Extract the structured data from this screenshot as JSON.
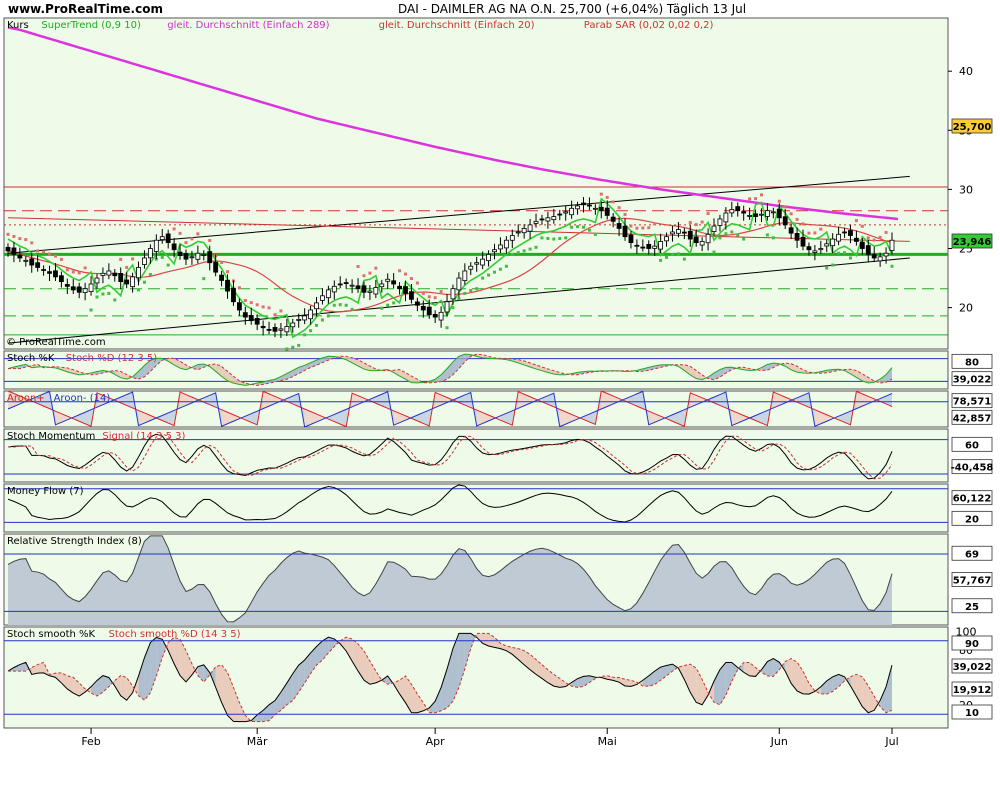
{
  "header": {
    "site": "www.ProRealTime.com",
    "title": "DAI - DAIMLER AG NA O.N.   25,700 (+6,04%)   Täglich  13 Jul",
    "copyright": "© ProRealTime.com"
  },
  "colors": {
    "panel_bg": "#eefbe8",
    "supertrend": "#33cc33",
    "sma289": "#dd33dd",
    "sma20": "#dd4444",
    "sar": "#e07070",
    "stoch_d": "#cc3333",
    "aroon_up": "#dd2222",
    "aroon_down": "#2233cc",
    "rsi_fill": "#c0cad4",
    "level_line": "#2233cc",
    "price_badge": "#ffcc33"
  },
  "legends": [
    [
      {
        "text": "Kurs",
        "color": "#000000"
      },
      {
        "text": "SuperTrend (0,9 10)",
        "color": "#22aa22"
      },
      {
        "text": "gleit. Durchschnitt (Einfach 289)",
        "color": "#cc33cc"
      },
      {
        "text": "gleit. Durchschnitt (Einfach 20)",
        "color": "#cc3333"
      },
      {
        "text": "Parab SAR (0,02 0,02 0,2)",
        "color": "#cc3333"
      }
    ],
    [
      {
        "text": "Stoch %K",
        "color": "#000000"
      },
      {
        "text": "Stoch %D (12 3 5)",
        "color": "#cc3333"
      }
    ],
    [
      {
        "text": "Aroon+",
        "color": "#cc2222"
      },
      {
        "text": "Aroon- (14)",
        "color": "#2233cc"
      }
    ],
    [
      {
        "text": "Stoch Momentum",
        "color": "#000000"
      },
      {
        "text": "Signal (14 3 5 3)",
        "color": "#cc3333"
      }
    ],
    [
      {
        "text": "Money Flow (7)",
        "color": "#000000"
      }
    ],
    [
      {
        "text": "Relative Strength Index (8)",
        "color": "#000000"
      }
    ],
    [
      {
        "text": "Stoch smooth %K",
        "color": "#000000"
      },
      {
        "text": "Stoch smooth %D (14 3 5)",
        "color": "#cc3333"
      }
    ]
  ],
  "chart_data": {
    "type": "candlestick",
    "x_months": [
      "Feb",
      "Mär",
      "Apr",
      "Mai",
      "Jun",
      "Jul"
    ],
    "last_date": "13 Jul",
    "last_close": 25.7,
    "change_pct": "+6,04%",
    "price_ylim": [
      16.5,
      44.5
    ],
    "price_ticks": [
      "20",
      "25",
      "30",
      "35",
      "40"
    ],
    "closes": [
      24.8,
      24.5,
      24.2,
      24.0,
      23.6,
      23.4,
      23.2,
      22.9,
      22.6,
      22.2,
      21.8,
      21.5,
      21.3,
      21.6,
      22.0,
      22.5,
      22.9,
      23.1,
      22.7,
      22.2,
      22.0,
      22.6,
      23.4,
      24.2,
      25.0,
      25.7,
      26.0,
      25.5,
      24.9,
      24.4,
      24.1,
      24.3,
      24.6,
      24.5,
      23.8,
      23.0,
      22.3,
      21.4,
      20.5,
      19.8,
      19.2,
      18.9,
      18.6,
      18.3,
      18.1,
      18.0,
      18.2,
      18.4,
      18.7,
      19.0,
      19.3,
      19.8,
      20.4,
      21.0,
      21.5,
      21.8,
      22.0,
      22.1,
      21.9,
      21.6,
      21.3,
      21.4,
      21.7,
      22.0,
      22.4,
      22.0,
      21.6,
      21.2,
      20.7,
      20.2,
      19.8,
      19.4,
      19.2,
      19.6,
      20.5,
      21.6,
      22.5,
      23.1,
      23.5,
      23.8,
      24.1,
      24.5,
      24.9,
      25.3,
      25.7,
      26.1,
      26.4,
      26.7,
      27.0,
      27.3,
      27.5,
      27.6,
      27.7,
      27.9,
      28.1,
      28.4,
      28.6,
      28.7,
      28.6,
      28.4,
      28.2,
      27.8,
      27.3,
      26.7,
      26.0,
      25.5,
      25.2,
      25.1,
      25.0,
      25.2,
      25.6,
      26.0,
      26.4,
      26.6,
      26.3,
      25.8,
      25.5,
      25.6,
      26.2,
      26.9,
      27.5,
      28.0,
      28.3,
      28.2,
      28.0,
      27.8,
      27.7,
      27.9,
      28.2,
      28.1,
      27.6,
      27.0,
      26.3,
      25.7,
      25.2,
      24.9,
      24.8,
      25.0,
      25.4,
      25.8,
      26.2,
      26.4,
      26.1,
      25.6,
      25.0,
      24.5,
      24.2,
      24.3,
      24.6,
      25.7
    ],
    "sma289": [
      43.7,
      43.6,
      43.5,
      43.35,
      43.2,
      43.05,
      42.9,
      42.75,
      42.6,
      42.45,
      42.3,
      42.15,
      42.0,
      41.85,
      41.7,
      41.55,
      41.4,
      41.25,
      41.1,
      40.95,
      40.8,
      40.65,
      40.5,
      40.35,
      40.2,
      40.05,
      39.9,
      39.75,
      39.6,
      39.45,
      39.3,
      39.15,
      39.0,
      38.85,
      38.7,
      38.55,
      38.4,
      38.25,
      38.1,
      37.95,
      37.8,
      37.65,
      37.5,
      37.35,
      37.2,
      37.05,
      36.9,
      36.75,
      36.6,
      36.45,
      36.3,
      36.15,
      36.0,
      35.88,
      35.76,
      35.64,
      35.52,
      35.4,
      35.28,
      35.16,
      35.04,
      34.92,
      34.8,
      34.68,
      34.56,
      34.44,
      34.32,
      34.2,
      34.08,
      33.96,
      33.84,
      33.72,
      33.6,
      33.49,
      33.38,
      33.27,
      33.16,
      33.05,
      32.94,
      32.83,
      32.72,
      32.61,
      32.5,
      32.4,
      32.3,
      32.2,
      32.1,
      32.0,
      31.9,
      31.8,
      31.7,
      31.61,
      31.52,
      31.43,
      31.34,
      31.25,
      31.16,
      31.07,
      30.98,
      30.89,
      30.8,
      30.72,
      30.64,
      30.56,
      30.48,
      30.4,
      30.32,
      30.24,
      30.16,
      30.08,
      30.0,
      29.93,
      29.86,
      29.79,
      29.72,
      29.65,
      29.58,
      29.51,
      29.44,
      29.37,
      29.3,
      29.23,
      29.16,
      29.09,
      29.02,
      28.95,
      28.88,
      28.81,
      28.74,
      28.67,
      28.6,
      28.54,
      28.48,
      28.42,
      28.36,
      28.3,
      28.24,
      28.18,
      28.12,
      28.06,
      28.0,
      27.95,
      27.9,
      27.85,
      27.8,
      27.75,
      27.7,
      27.65,
      27.6,
      27.55,
      27.5
    ],
    "trendlines_price": [
      {
        "from": [
          0,
          24.6
        ],
        "to": [
          152,
          31.1
        ],
        "role": "upper channel"
      },
      {
        "from": [
          0,
          17.0
        ],
        "to": [
          152,
          24.2
        ],
        "role": "lower channel"
      },
      {
        "from": [
          0,
          27.6
        ],
        "to": [
          152,
          25.6
        ],
        "role": "red resistance"
      },
      {
        "from": [
          0,
          24.5
        ],
        "to": [
          152,
          24.5
        ],
        "role": "green support"
      }
    ],
    "horizontal_levels_price": [
      30.2,
      28.2,
      27.0,
      24.5,
      21.6,
      19.3,
      17.7
    ],
    "value_badges": [
      {
        "panel": "price",
        "value": "25,700",
        "color": "#ffcc33"
      },
      {
        "panel": "price",
        "value": "23,946",
        "color": "#33cc33"
      },
      {
        "panel": "stoch",
        "value": "80"
      },
      {
        "panel": "stoch",
        "value": "39,022"
      },
      {
        "panel": "aroon",
        "value": "78,571"
      },
      {
        "panel": "aroon",
        "value": "42,857"
      },
      {
        "panel": "momentum",
        "value": "60"
      },
      {
        "panel": "momentum",
        "value": "-40,458"
      },
      {
        "panel": "moneyflow",
        "value": "60,122"
      },
      {
        "panel": "moneyflow",
        "value": "20"
      },
      {
        "panel": "rsi",
        "value": "69"
      },
      {
        "panel": "rsi",
        "value": "57,767"
      },
      {
        "panel": "rsi",
        "value": "25"
      },
      {
        "panel": "stoch_smooth",
        "value": "90"
      },
      {
        "panel": "stoch_smooth",
        "value": "39,022"
      },
      {
        "panel": "stoch_smooth",
        "value": "19,912"
      },
      {
        "panel": "stoch_smooth",
        "value": "10"
      }
    ],
    "stoch_smooth_ticks": [
      "20",
      "40",
      "60",
      "80",
      "100"
    ],
    "stoch_smooth_ylim": [
      -5,
      105
    ]
  }
}
